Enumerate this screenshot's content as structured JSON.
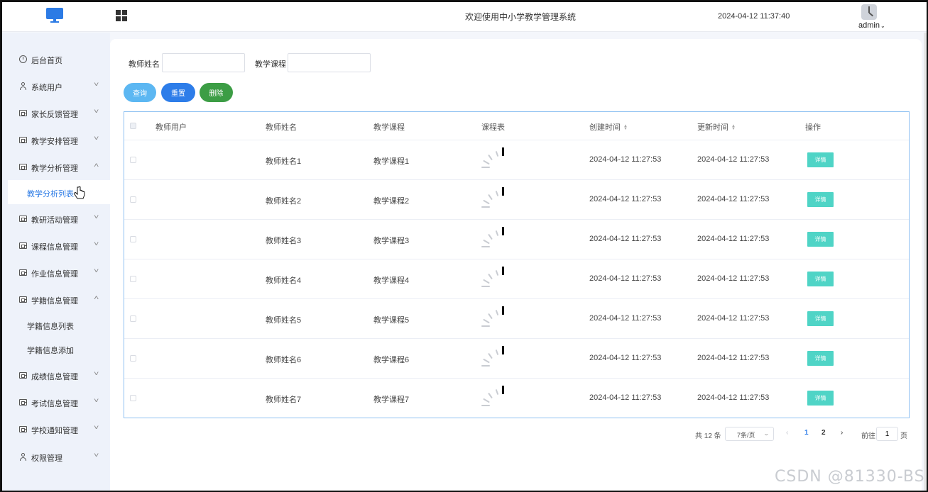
{
  "header": {
    "welcome": "欢迎使用中小学教学管理系统",
    "datetime": "2024-04-12 11:37:40",
    "user": "admin"
  },
  "sidebar": {
    "items": [
      {
        "label": "后台首页",
        "icon": "clock-icon"
      },
      {
        "label": "系统用户",
        "icon": "user-icon",
        "chevron": "down"
      },
      {
        "label": "家长反馈管理",
        "icon": "card-icon",
        "chevron": "down"
      },
      {
        "label": "教学安排管理",
        "icon": "card-icon",
        "chevron": "down"
      },
      {
        "label": "教学分析管理",
        "icon": "card-icon",
        "chevron": "up",
        "expanded": true
      },
      {
        "label": "教研活动管理",
        "icon": "card-icon",
        "chevron": "down"
      },
      {
        "label": "课程信息管理",
        "icon": "card-icon",
        "chevron": "down"
      },
      {
        "label": "作业信息管理",
        "icon": "card-icon",
        "chevron": "down"
      },
      {
        "label": "学籍信息管理",
        "icon": "card-icon",
        "chevron": "up",
        "expanded": true
      },
      {
        "label": "成绩信息管理",
        "icon": "card-icon",
        "chevron": "down"
      },
      {
        "label": "考试信息管理",
        "icon": "card-icon",
        "chevron": "down"
      },
      {
        "label": "学校通知管理",
        "icon": "card-icon",
        "chevron": "down"
      },
      {
        "label": "权限管理",
        "icon": "user-icon",
        "chevron": "down"
      }
    ],
    "sub_analysis": [
      "教学分析列表"
    ],
    "sub_student": [
      "学籍信息列表",
      "学籍信息添加"
    ],
    "active": "教学分析列表"
  },
  "search": {
    "teacher_name_label": "教师姓名",
    "teacher_name_value": "",
    "course_label": "教学课程",
    "course_value": ""
  },
  "actions": {
    "query": "查询",
    "reset": "重置",
    "delete": "删除"
  },
  "table": {
    "columns": [
      "教师用户",
      "教师姓名",
      "教学课程",
      "课程表",
      "创建时间",
      "更新时间",
      "操作"
    ],
    "rows": [
      {
        "user": "",
        "name": "教师姓名1",
        "course": "教学课程1",
        "created": "2024-04-12 11:27:53",
        "updated": "2024-04-12 11:27:53",
        "action": "详情"
      },
      {
        "user": "",
        "name": "教师姓名2",
        "course": "教学课程2",
        "created": "2024-04-12 11:27:53",
        "updated": "2024-04-12 11:27:53",
        "action": "详情"
      },
      {
        "user": "",
        "name": "教师姓名3",
        "course": "教学课程3",
        "created": "2024-04-12 11:27:53",
        "updated": "2024-04-12 11:27:53",
        "action": "详情"
      },
      {
        "user": "",
        "name": "教师姓名4",
        "course": "教学课程4",
        "created": "2024-04-12 11:27:53",
        "updated": "2024-04-12 11:27:53",
        "action": "详情"
      },
      {
        "user": "",
        "name": "教师姓名5",
        "course": "教学课程5",
        "created": "2024-04-12 11:27:53",
        "updated": "2024-04-12 11:27:53",
        "action": "详情"
      },
      {
        "user": "",
        "name": "教师姓名6",
        "course": "教学课程6",
        "created": "2024-04-12 11:27:53",
        "updated": "2024-04-12 11:27:53",
        "action": "详情"
      },
      {
        "user": "",
        "name": "教师姓名7",
        "course": "教学课程7",
        "created": "2024-04-12 11:27:53",
        "updated": "2024-04-12 11:27:53",
        "action": "详情"
      }
    ]
  },
  "pagination": {
    "total": "共 12 条",
    "page_size": "7条/页",
    "pages": [
      "1",
      "2"
    ],
    "current": "1",
    "goto_label": "前往",
    "goto_value": "1",
    "page_unit": "页"
  },
  "watermark": "CSDN @81330-BS",
  "colors": {
    "primary": "#2d7de9",
    "query": "#5cb7f2",
    "delete": "#3c9d45",
    "detail": "#4fd4c6",
    "sidebar_bg": "#eef2fa"
  }
}
